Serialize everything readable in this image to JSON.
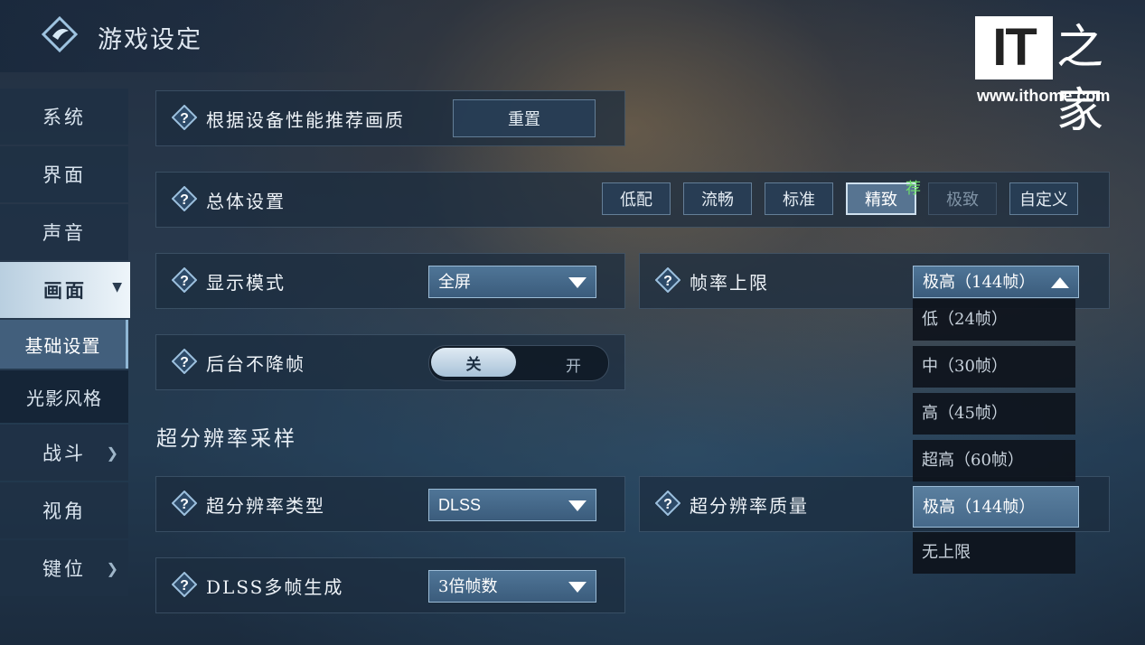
{
  "window": {
    "title": "游戏设定"
  },
  "watermark": {
    "brand": "IT之家",
    "url": "www.ithome.com"
  },
  "sidebar": {
    "items": [
      {
        "label": "系统"
      },
      {
        "label": "界面"
      },
      {
        "label": "声音"
      },
      {
        "label": "画面"
      },
      {
        "label": "基础设置"
      },
      {
        "label": "光影风格"
      },
      {
        "label": "战斗"
      },
      {
        "label": "视角"
      },
      {
        "label": "键位"
      }
    ]
  },
  "settings": {
    "recommend": {
      "label": "根据设备性能推荐画质",
      "button": "重置"
    },
    "overall": {
      "label": "总体设置",
      "presets": [
        "低配",
        "流畅",
        "标准",
        "精致",
        "极致",
        "自定义"
      ],
      "selected": "精致",
      "recommended_badge": "荐"
    },
    "display_mode": {
      "label": "显示模式",
      "value": "全屏"
    },
    "frame_limit": {
      "label": "帧率上限",
      "value": "极高（144帧）",
      "options": [
        "低（24帧）",
        "中（30帧）",
        "高（45帧）",
        "超高（60帧）",
        "极高（144帧）",
        "无上限"
      ]
    },
    "background_fps": {
      "label": "后台不降帧",
      "on_label": "关",
      "off_label": "开",
      "state": "关"
    },
    "super_res_section": "超分辨率采样",
    "super_res_type": {
      "label": "超分辨率类型",
      "value": "DLSS"
    },
    "super_res_quality": {
      "label": "超分辨率质量"
    },
    "dlss_mfg": {
      "label": "DLSS多帧生成",
      "value": "3倍帧数"
    }
  },
  "colors": {
    "accent": "#9cbcd6",
    "recommend_green": "#6fe06a"
  }
}
